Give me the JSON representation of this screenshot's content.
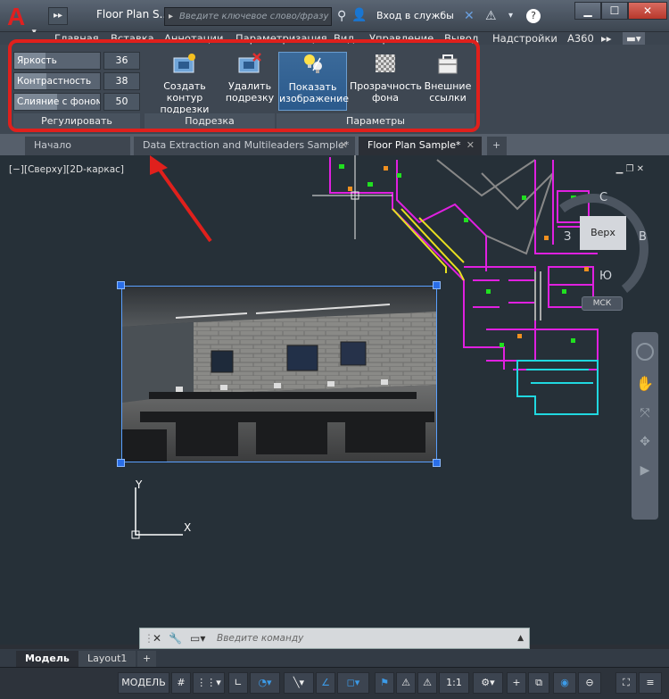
{
  "title": {
    "doc_title": "Floor Plan S...",
    "search_placeholder": "Введите ключевое слово/фразу",
    "sign_in": "Вход в службы",
    "help": "?",
    "min": "▁",
    "max": "☐",
    "close": "✕"
  },
  "ribbon_tabs": [
    "Главная",
    "Вставка",
    "Аннотации",
    "Параметризация",
    "Вид",
    "Управление",
    "Вывод",
    "Надстройки",
    "A360"
  ],
  "adjust": {
    "brightness_label": "Яркость",
    "brightness_value": "36",
    "contrast_label": "Контрастность",
    "contrast_value": "38",
    "fade_label": "Слияние с фоном",
    "fade_value": "50",
    "panel_label": "Регулировать"
  },
  "clip": {
    "create_label_1": "Создать контур",
    "create_label_2": "подрезки",
    "remove_label_1": "Удалить",
    "remove_label_2": "подрезку",
    "panel_label": "Подрезка"
  },
  "options": {
    "show_label_1": "Показать",
    "show_label_2": "изображение",
    "transparency_label_1": "Прозрачность",
    "transparency_label_2": "фона",
    "xref_label_1": "Внешние",
    "xref_label_2": "ссылки",
    "panel_label": "Параметры"
  },
  "doc_tabs": [
    "Начало",
    "Data Extraction and Multileaders Sample*",
    "Floor Plan Sample*"
  ],
  "viewport_label": "[−][Сверху][2D-каркас]",
  "viewcube": {
    "north": "С",
    "west": "З",
    "east": "В",
    "south": "Ю",
    "face": "Верх",
    "ucs": "МСК"
  },
  "ucs_icon": {
    "y": "Y",
    "x": "X"
  },
  "command": {
    "placeholder": "Введите команду"
  },
  "layout_tabs": [
    "Модель",
    "Layout1"
  ],
  "status": {
    "model": "МОДЕЛЬ",
    "scale": "1:1"
  },
  "colors": {
    "accent_red": "#e0201c",
    "selection_blue": "#2a6ee8",
    "active_button": "#2b5a8c"
  }
}
